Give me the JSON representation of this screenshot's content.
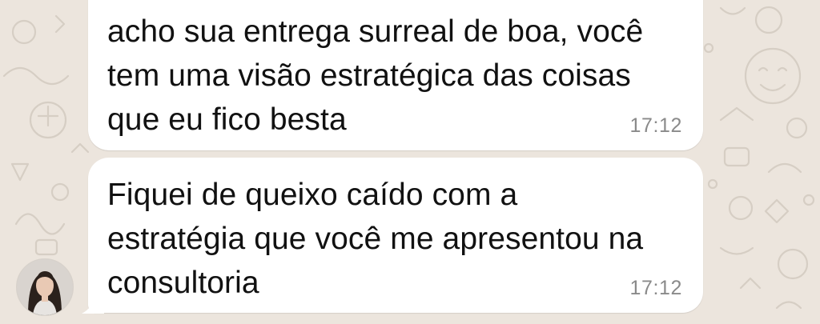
{
  "chat": {
    "background_color": "#ece5dd",
    "bubble_color": "#ffffff",
    "messages": [
      {
        "text": "acho sua entrega surreal de boa, você\ntem uma visão estratégica das coisas\nque eu fico besta",
        "time": "17:12"
      },
      {
        "text": "Fiquei de queixo caído com a\nestratégia que você me apresentou na\nconsultoria",
        "time": "17:12"
      }
    ],
    "sender_avatar_icon": "profile-photo-avatar"
  }
}
